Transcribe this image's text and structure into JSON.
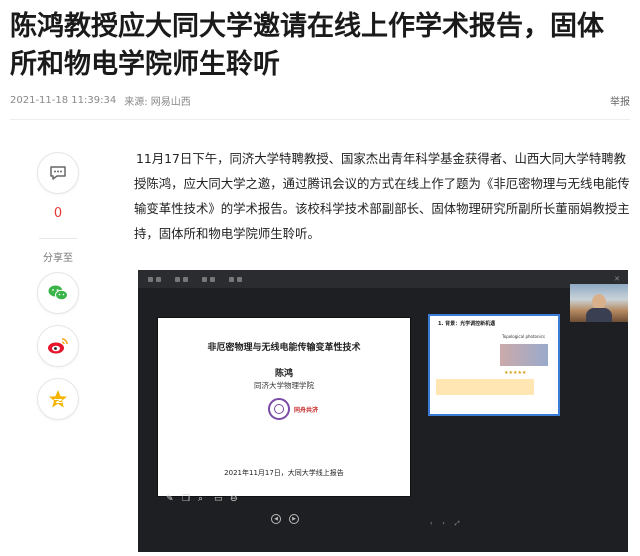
{
  "article": {
    "title": "陈鸿教授应大同大学邀请在线上作学术报告，固体所和物电学院师生聆听",
    "timestamp": "2021-11-18 11:39:34",
    "source": "来源: 网易山西",
    "report_label": "举报",
    "paragraph": "11月17日下午，同济大学特聘教授、国家杰出青年科学基金获得者、山西大同大学特聘教授陈鸿，应大同大学之邀，通过腾讯会议的方式在线上作了题为《非厄密物理与无线电能传输变革性技术》的学术报告。该校科学技术部副部长、固体物理研究所副所长董丽娟教授主持，固体所和物电学院师生聆听。"
  },
  "sidebar": {
    "comment_count": "0",
    "share_label": "分享至",
    "icons": [
      "comment-icon",
      "wechat-icon",
      "weibo-icon",
      "qzone-icon"
    ]
  },
  "meeting_screenshot": {
    "slide": {
      "title": "非厄密物理与无线电能传输变革性技术",
      "speaker": "陈鸿",
      "affiliation": "同济大学物理学院",
      "motto": "同舟共济",
      "date_line": "2021年11月17日，大同大学线上报告"
    },
    "thumbnail": {
      "heading": "1. 背景：光学调控新机遇",
      "right_heading": "Topological photonics",
      "stars": "★★★★★"
    }
  },
  "colors": {
    "count_red": "#e53935",
    "wechat_green": "#3bb54a",
    "weibo_red": "#e6162d",
    "qzone_gold": "#f5b400"
  }
}
